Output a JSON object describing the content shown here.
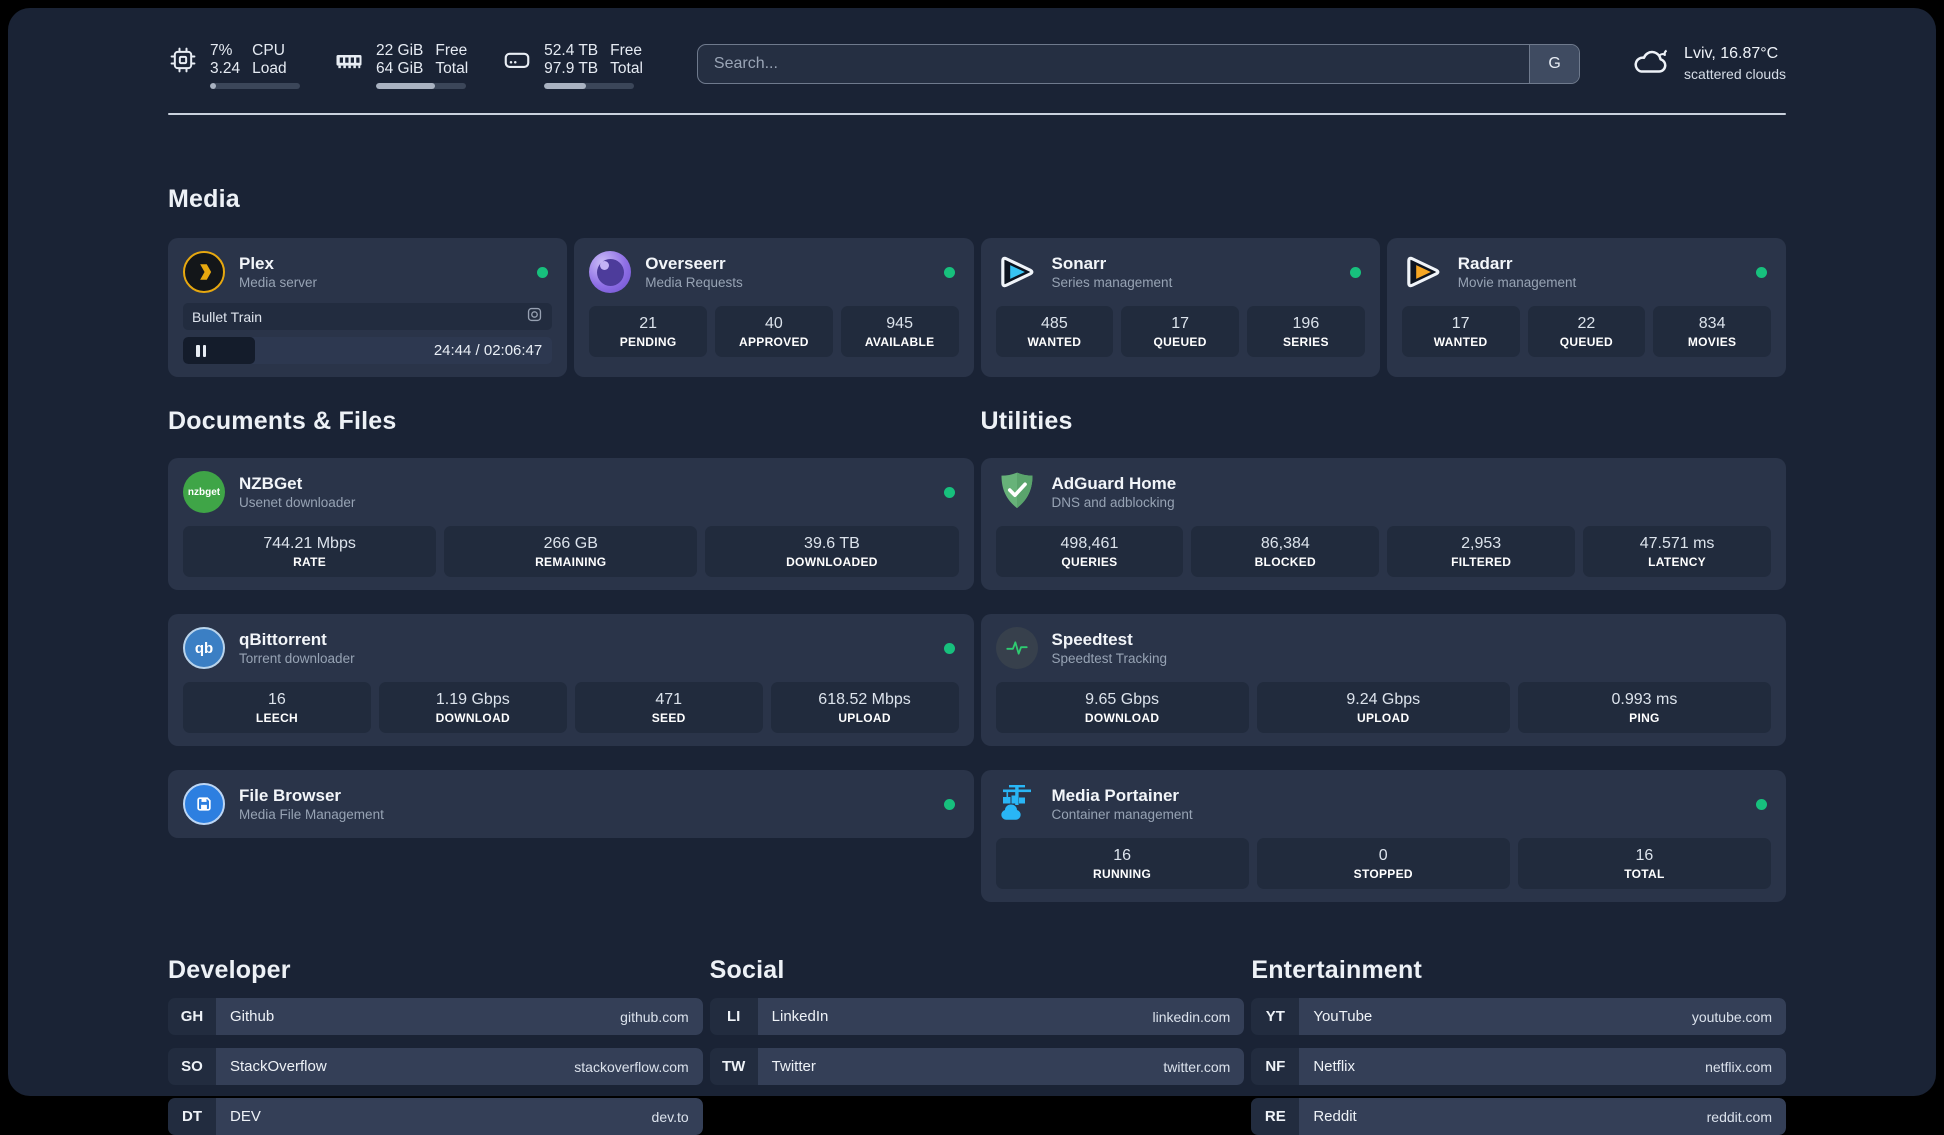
{
  "header": {
    "stats": [
      {
        "icon": "cpu-icon",
        "values": [
          "7%",
          "3.24"
        ],
        "labels": [
          "CPU",
          "Load"
        ],
        "progress_pct": 7
      },
      {
        "icon": "ram-icon",
        "values": [
          "22 GiB",
          "64 GiB"
        ],
        "labels": [
          "Free",
          "Total"
        ],
        "progress_pct": 66
      },
      {
        "icon": "disk-icon",
        "values": [
          "52.4 TB",
          "97.9 TB"
        ],
        "labels": [
          "Free",
          "Total"
        ],
        "progress_pct": 46
      }
    ],
    "search": {
      "placeholder": "Search...",
      "engine_button": "G"
    },
    "weather": {
      "location": "Lviv, 16.87°C",
      "condition": "scattered clouds"
    }
  },
  "sections": {
    "media": {
      "title": "Media",
      "apps": [
        {
          "name": "Plex",
          "subtitle": "Media server",
          "online": true,
          "player": {
            "title": "Bullet Train",
            "time": "24:44 / 02:06:47"
          }
        },
        {
          "name": "Overseerr",
          "subtitle": "Media Requests",
          "online": true,
          "stats": [
            {
              "value": "21",
              "label": "PENDING"
            },
            {
              "value": "40",
              "label": "APPROVED"
            },
            {
              "value": "945",
              "label": "AVAILABLE"
            }
          ]
        },
        {
          "name": "Sonarr",
          "subtitle": "Series management",
          "online": true,
          "stats": [
            {
              "value": "485",
              "label": "WANTED"
            },
            {
              "value": "17",
              "label": "QUEUED"
            },
            {
              "value": "196",
              "label": "SERIES"
            }
          ]
        },
        {
          "name": "Radarr",
          "subtitle": "Movie management",
          "online": true,
          "stats": [
            {
              "value": "17",
              "label": "WANTED"
            },
            {
              "value": "22",
              "label": "QUEUED"
            },
            {
              "value": "834",
              "label": "MOVIES"
            }
          ]
        }
      ]
    },
    "documents": {
      "title": "Documents & Files",
      "apps": [
        {
          "name": "NZBGet",
          "subtitle": "Usenet downloader",
          "online": true,
          "icon_text": "nzbget",
          "stats": [
            {
              "value": "744.21 Mbps",
              "label": "RATE"
            },
            {
              "value": "266 GB",
              "label": "REMAINING"
            },
            {
              "value": "39.6 TB",
              "label": "DOWNLOADED"
            }
          ]
        },
        {
          "name": "qBittorrent",
          "subtitle": "Torrent downloader",
          "online": true,
          "icon_text": "qb",
          "stats": [
            {
              "value": "16",
              "label": "LEECH"
            },
            {
              "value": "1.19 Gbps",
              "label": "DOWNLOAD"
            },
            {
              "value": "471",
              "label": "SEED"
            },
            {
              "value": "618.52 Mbps",
              "label": "UPLOAD"
            }
          ]
        },
        {
          "name": "File Browser",
          "subtitle": "Media File Management",
          "online": true
        }
      ]
    },
    "utilities": {
      "title": "Utilities",
      "apps": [
        {
          "name": "AdGuard Home",
          "subtitle": "DNS and adblocking",
          "online": false,
          "stats": [
            {
              "value": "498,461",
              "label": "QUERIES"
            },
            {
              "value": "86,384",
              "label": "BLOCKED"
            },
            {
              "value": "2,953",
              "label": "FILTERED"
            },
            {
              "value": "47.571 ms",
              "label": "LATENCY"
            }
          ]
        },
        {
          "name": "Speedtest",
          "subtitle": "Speedtest Tracking",
          "online": false,
          "stats": [
            {
              "value": "9.65 Gbps",
              "label": "DOWNLOAD"
            },
            {
              "value": "9.24 Gbps",
              "label": "UPLOAD"
            },
            {
              "value": "0.993 ms",
              "label": "PING"
            }
          ]
        },
        {
          "name": "Media Portainer",
          "subtitle": "Container management",
          "online": true,
          "stats": [
            {
              "value": "16",
              "label": "RUNNING"
            },
            {
              "value": "0",
              "label": "STOPPED"
            },
            {
              "value": "16",
              "label": "TOTAL"
            }
          ]
        }
      ]
    },
    "developer": {
      "title": "Developer",
      "links": [
        {
          "abbr": "GH",
          "name": "Github",
          "url": "github.com"
        },
        {
          "abbr": "SO",
          "name": "StackOverflow",
          "url": "stackoverflow.com"
        },
        {
          "abbr": "DT",
          "name": "DEV",
          "url": "dev.to"
        }
      ]
    },
    "social": {
      "title": "Social",
      "links": [
        {
          "abbr": "LI",
          "name": "LinkedIn",
          "url": "linkedin.com"
        },
        {
          "abbr": "TW",
          "name": "Twitter",
          "url": "twitter.com"
        }
      ]
    },
    "entertainment": {
      "title": "Entertainment",
      "links": [
        {
          "abbr": "YT",
          "name": "YouTube",
          "url": "youtube.com"
        },
        {
          "abbr": "NF",
          "name": "Netflix",
          "url": "netflix.com"
        },
        {
          "abbr": "RE",
          "name": "Reddit",
          "url": "reddit.com"
        }
      ]
    }
  }
}
